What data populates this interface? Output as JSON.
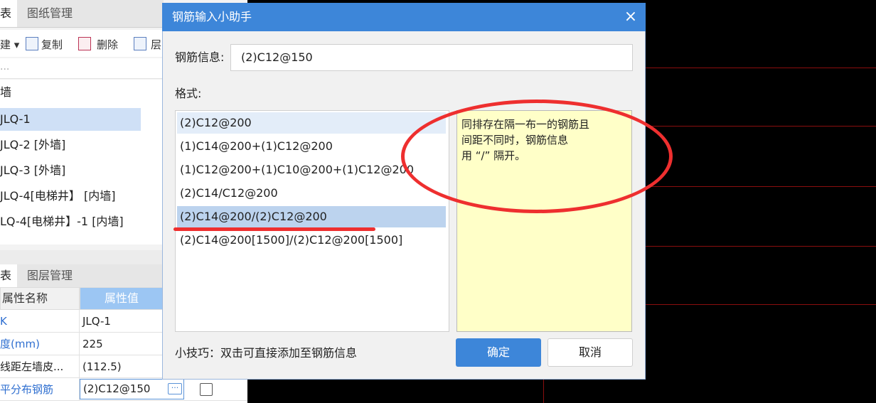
{
  "left": {
    "tabs_top": [
      "表",
      "图纸管理"
    ],
    "toolbar": {
      "copy": "复制",
      "delete": "删除",
      "layer": "层"
    },
    "search_placeholder": "...",
    "tree": {
      "group": "墙",
      "items": [
        "JLQ-1",
        "JLQ-2 [外墙]",
        "JLQ-3 [外墙]",
        "JLQ-4[电梯井】 [内墙]",
        "LQ-4[电梯井】-1 [内墙]"
      ]
    },
    "tabs_bottom": [
      "表",
      "图层管理"
    ],
    "prop_table": {
      "col_name": "属性名称",
      "col_value": "属性值",
      "rows": [
        {
          "name": "K",
          "value": "JLQ-1"
        },
        {
          "name": "度(mm)",
          "value": "225"
        },
        {
          "name": "线距左墙皮...",
          "value": "(112.5)"
        },
        {
          "name": "平分布钢筋",
          "value": "(2)C12@150"
        }
      ],
      "ellipsis": "···"
    }
  },
  "dialog": {
    "title": "钢筋输入小助手",
    "close": "×",
    "info_label": "钢筋信息:",
    "info_value": "(2)C12@150",
    "format_label": "格式:",
    "formats": [
      "(2)C12@200",
      "(1)C14@200+(1)C12@200",
      "(1)C12@200+(1)C10@200+(1)C12@200",
      "(2)C14/C12@200",
      "(2)C14@200/(2)C12@200",
      "(2)C14@200[1500]/(2)C12@200[1500]"
    ],
    "selected_index": 4,
    "tip_lines": [
      "同排存在隔一布一的钢筋且",
      "间距不同时，钢筋信息",
      "用 “/” 隔开。"
    ],
    "hint": "小技巧：双击可直接添加至钢筋信息",
    "ok": "确定",
    "cancel": "取消"
  },
  "colors": {
    "accent": "#3d86d9",
    "annotation": "#ee2f2f",
    "tip_bg": "#ffffc8",
    "selected": "#bcd3ee"
  }
}
